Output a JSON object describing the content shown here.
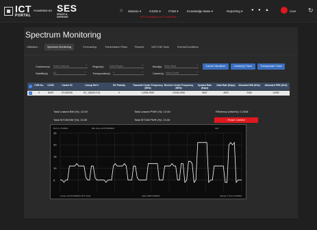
{
  "app": {
    "logo_main": "ICT",
    "logo_sub": "PORTAL",
    "powered_by": "POWERED BY",
    "brand": "SES",
    "brand_sub": "SPACE & DEFENSE",
    "proprietary_notice": "*SES Proprietary and Confidential*"
  },
  "nav": {
    "home_icon": "home-icon",
    "items": [
      {
        "label": "Mission ▾"
      },
      {
        "label": "GSOE ▾"
      },
      {
        "label": "ITSM ▾"
      },
      {
        "label": "Knowledge Base ▾"
      },
      {
        "label": "Reporting ▾"
      }
    ],
    "user_label": "User",
    "icons": [
      "bell-icon",
      "lock-icon",
      "print-icon",
      "refresh-icon"
    ]
  },
  "page": {
    "title": "Spectrum Monitoring",
    "tabs": [
      {
        "label": "Utilization",
        "active": false
      },
      {
        "label": "Spectrum Monitoring",
        "active": true
      },
      {
        "label": "Forecasting",
        "active": false
      },
      {
        "label": "Transmission Plans",
        "active": false
      },
      {
        "label": "Reports",
        "active": false
      },
      {
        "label": "SATCOM Tools",
        "active": false
      },
      {
        "label": "Events/Conditions",
        "active": false
      }
    ]
  },
  "filters": {
    "customer_label": "Customer(s)",
    "customer_value": "Select Customer",
    "region_label": "Region(s)",
    "region_value": "Select Region",
    "band_label": "Band(s)",
    "band_value": "Select Band",
    "satellite_label": "Satellite(s)",
    "satellite_value": "NC",
    "transponder_label": "Transponder(s)",
    "transponder_value": "Y",
    "carrier_label": "Carrier(s)",
    "carrier_value": "Select Carrier",
    "btn_carrier_visualizer": "Carrier Visualizer",
    "btn_carrier_trace": "Carrier(s) Trace",
    "btn_transponder_trace": "Transponder Trace"
  },
  "table": {
    "headers": [
      "CXR No.",
      "CCSD",
      "Carrier ID",
      "Lineup Ref #",
      "SG Polarity",
      "Transmit Center Frequency (MHz)",
      "Receive Center Frequency (MHz)",
      "Symbol Rate (Ksps)",
      "Data Rate (Kbps)",
      "Allocated BW (KHz)",
      "Allocated PEB (KHz)"
    ],
    "rows": [
      [
        "X",
        "BWP",
        "ZXJ38150",
        "SC_38150-EY8",
        "V",
        "14306.2950",
        "12006.2950",
        "5667",
        "4890",
        "2380",
        "14382"
      ]
    ]
  },
  "stats": {
    "leased_bw": "Total Leased BW (%): 13.00",
    "leased_pwr": "Total Leased PWR (%): 13.00",
    "efficiency": "Efficiency (bits/Hz): 0.2448",
    "satcom_bw": "Total SITOM BW (%): 13.00",
    "satcom_pwr": "Total SITOM PWR (%): 13.00",
    "power_limited": "Power Limited"
  },
  "chart_data": {
    "type": "line",
    "y_ticks": [
      "25",
      "20",
      "15",
      "10",
      "5"
    ],
    "x_tick_labels": [
      "Center 14179.000MHz RTT 1kHz",
      "Span 5000.000MHz",
      "Sweep 1 Time 0.000MS"
    ],
    "header_text": [
      "Ref Lvl -5.0dBm",
      "Mkr Freq 14178.000MHz",
      "SAT"
    ],
    "series_color": "#ffffff",
    "grid": true,
    "series": [
      {
        "values": [
          5,
          5,
          4,
          5,
          5,
          11,
          11,
          11,
          11,
          12,
          11,
          11,
          11,
          11,
          6,
          5,
          5,
          11,
          11,
          6,
          5,
          5,
          5,
          5,
          5,
          4,
          5,
          5,
          5,
          11,
          12,
          11,
          11,
          11,
          11,
          12,
          11,
          5,
          5,
          5,
          11,
          11,
          6,
          5,
          5,
          5,
          5,
          5,
          12,
          12,
          12,
          12,
          12,
          12,
          5,
          5,
          5,
          11,
          11,
          11,
          11,
          12,
          11,
          11,
          5,
          5,
          12,
          12,
          4,
          5,
          13,
          13,
          12,
          4,
          5,
          21,
          21,
          21,
          21,
          21,
          21,
          4,
          5,
          5,
          11,
          11,
          11,
          11,
          11,
          11,
          4,
          4,
          20,
          21,
          20,
          21,
          4,
          5,
          5,
          5
        ]
      }
    ],
    "ylim": [
      0,
      25
    ]
  }
}
